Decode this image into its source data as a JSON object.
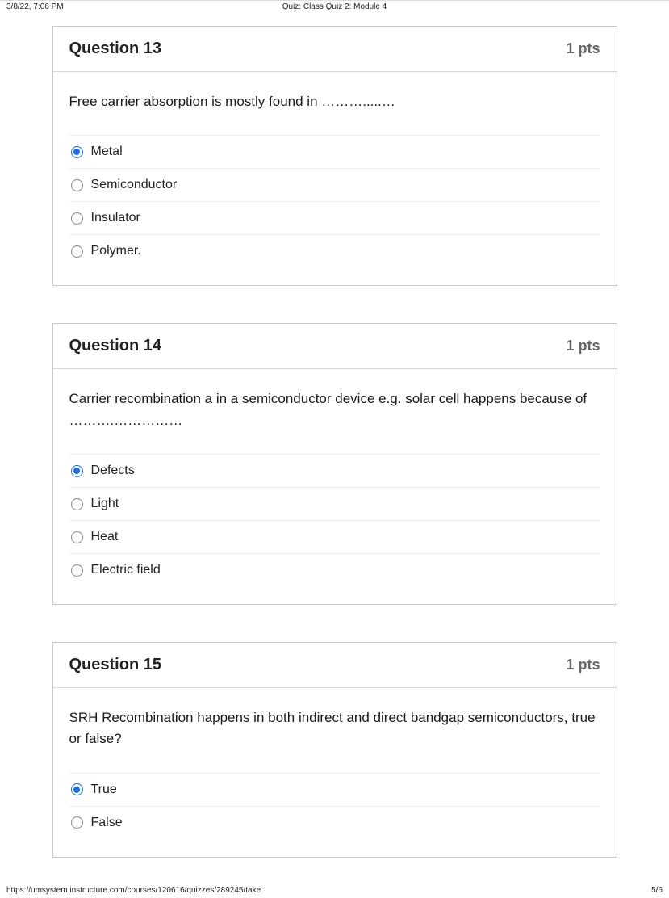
{
  "header": {
    "timestamp": "3/8/22, 7:06 PM",
    "title": "Quiz: Class Quiz 2: Module 4"
  },
  "footer": {
    "url": "https://umsystem.instructure.com/courses/120616/quizzes/289245/take",
    "page": "5/6"
  },
  "questions": [
    {
      "title": "Question 13",
      "pts": "1 pts",
      "text": "Free carrier absorption is mostly found in ……….....…",
      "options": [
        {
          "label": "Metal",
          "selected": true
        },
        {
          "label": "Semiconductor",
          "selected": false
        },
        {
          "label": "Insulator",
          "selected": false
        },
        {
          "label": "Polymer.",
          "selected": false
        }
      ]
    },
    {
      "title": "Question 14",
      "pts": "1 pts",
      "text": "Carrier recombination a in a semiconductor device e.g. solar cell happens because of ……….……………",
      "options": [
        {
          "label": "Defects",
          "selected": true
        },
        {
          "label": "Light",
          "selected": false
        },
        {
          "label": "Heat",
          "selected": false
        },
        {
          "label": "Electric field",
          "selected": false
        }
      ]
    },
    {
      "title": "Question 15",
      "pts": "1 pts",
      "text": "SRH Recombination happens in both indirect and direct bandgap semiconductors, true or false?",
      "options": [
        {
          "label": "True",
          "selected": true
        },
        {
          "label": "False",
          "selected": false
        }
      ]
    }
  ]
}
